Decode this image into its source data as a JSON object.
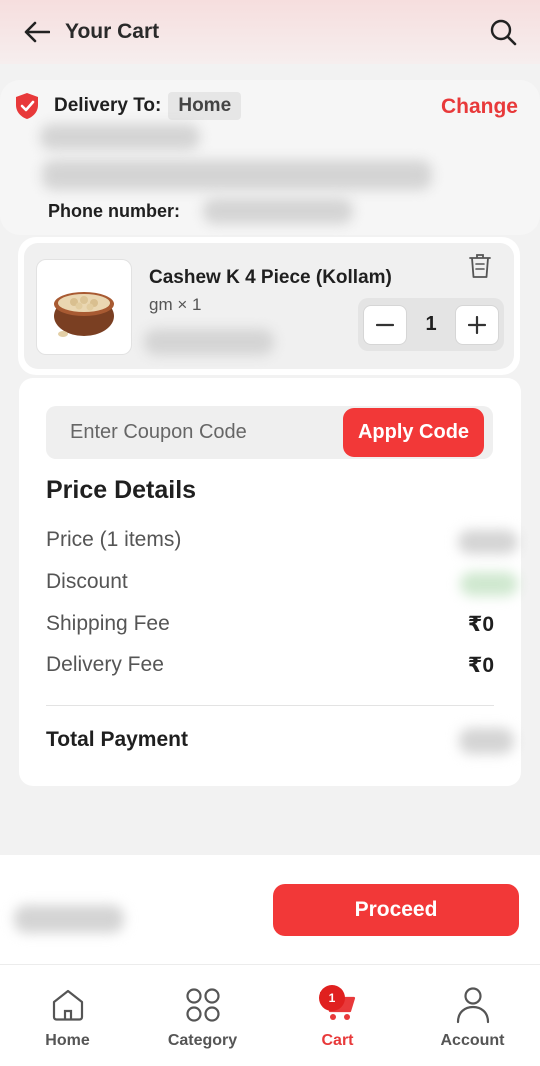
{
  "header": {
    "title": "Your Cart"
  },
  "address": {
    "delivery_label": "Delivery To:",
    "chip": "Home",
    "change_label": "Change",
    "phone_label": "Phone number:"
  },
  "cart_item": {
    "name": "Cashew K 4 Piece (Kollam)",
    "meta": "gm × 1",
    "quantity": "1"
  },
  "coupon": {
    "placeholder": "Enter Coupon Code",
    "apply_label": "Apply Code"
  },
  "price_details": {
    "title": "Price Details",
    "rows": [
      {
        "label": "Price (1 items)",
        "value": ""
      },
      {
        "label": "Discount",
        "value": ""
      },
      {
        "label": "Shipping Fee",
        "value": "₹0"
      },
      {
        "label": "Delivery Fee",
        "value": "₹0"
      }
    ],
    "total_label": "Total Payment"
  },
  "footer": {
    "proceed_label": "Proceed"
  },
  "bottom_nav": {
    "items": [
      {
        "label": "Home",
        "icon": "home-icon"
      },
      {
        "label": "Category",
        "icon": "grid-icon"
      },
      {
        "label": "Cart",
        "icon": "cart-icon",
        "badge": "1"
      },
      {
        "label": "Account",
        "icon": "user-icon"
      }
    ]
  },
  "colors": {
    "accent": "#f23838",
    "link": "#e8393a"
  }
}
